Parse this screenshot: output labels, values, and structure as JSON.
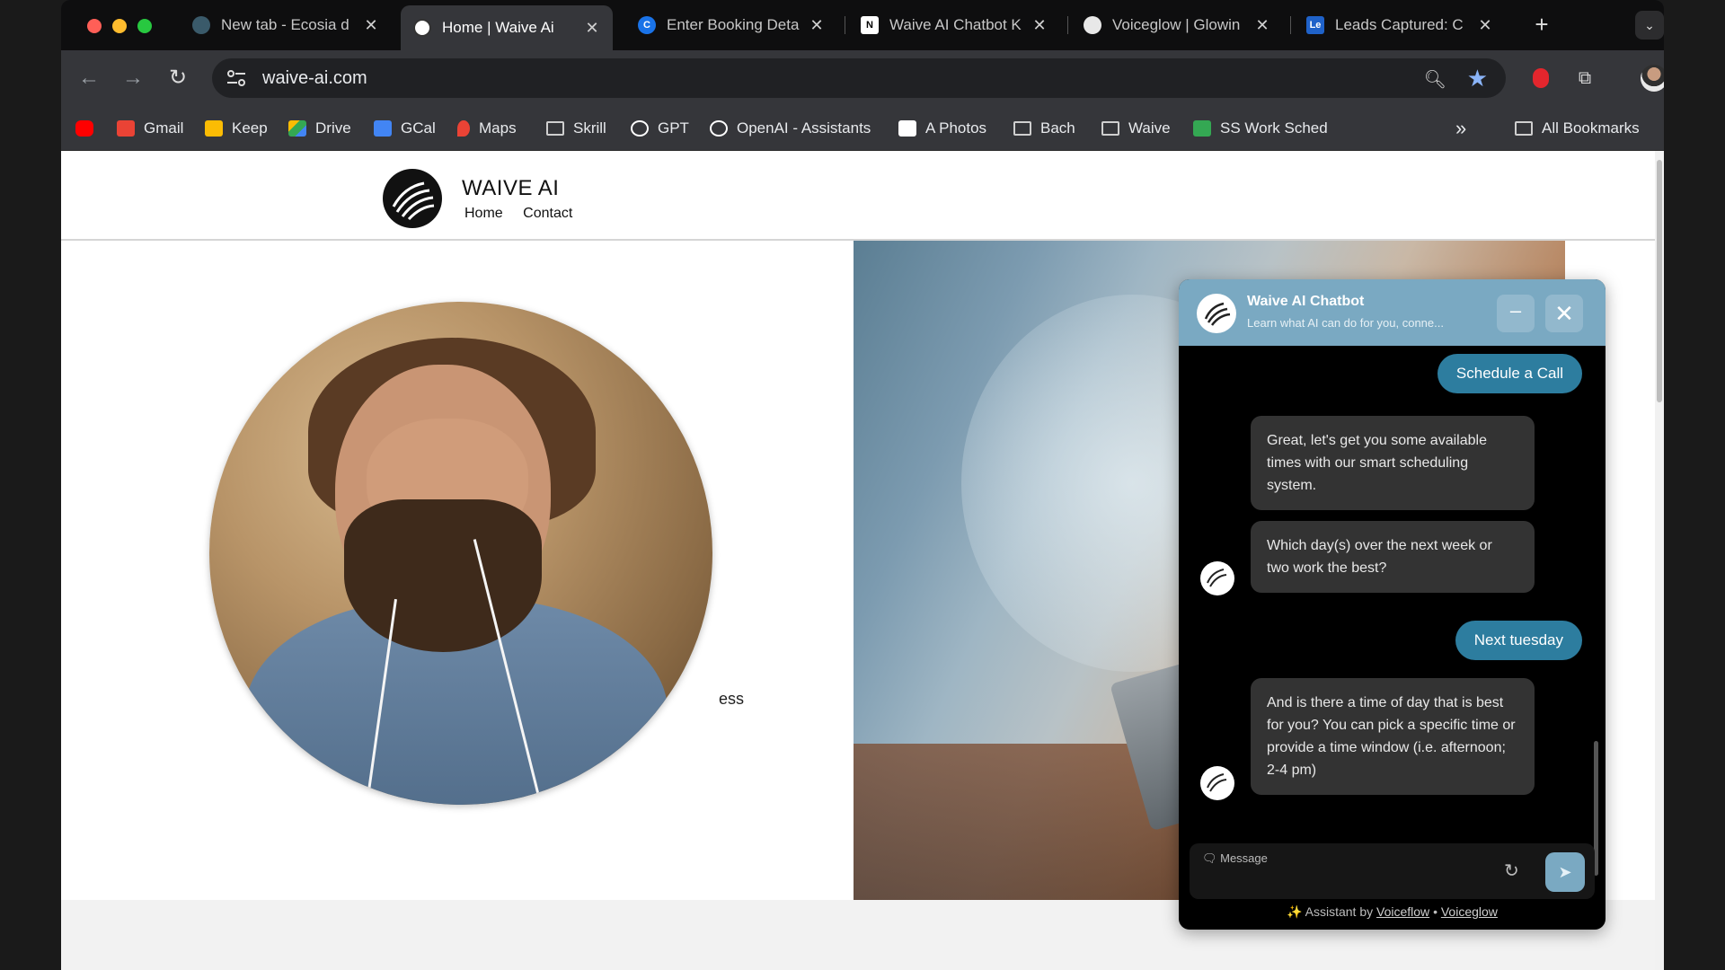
{
  "browser": {
    "tabs": [
      {
        "title": "New tab - Ecosia d",
        "favicon": "ecosia-icon",
        "active": false
      },
      {
        "title": "Home | Waive Ai",
        "favicon": "waive-icon",
        "active": true
      },
      {
        "title": "Enter Booking Deta",
        "favicon": "calendly-icon",
        "active": false
      },
      {
        "title": "Waive AI Chatbot K",
        "favicon": "notion-icon",
        "active": false
      },
      {
        "title": "Voiceglow | Glowin",
        "favicon": "voiceglow-icon",
        "active": false
      },
      {
        "title": "Leads Captured: C",
        "favicon": "le-icon",
        "active": false
      }
    ],
    "le_favicon_text": "Le",
    "address": "waive-ai.com",
    "bookmarks": [
      {
        "label": "",
        "icon": "youtube-icon",
        "color": "#ff0000"
      },
      {
        "label": "Gmail",
        "icon": "gmail-icon",
        "color": "#ea4335"
      },
      {
        "label": "Keep",
        "icon": "keep-icon",
        "color": "#fbbc04"
      },
      {
        "label": "Drive",
        "icon": "drive-icon",
        "color": "#34a853"
      },
      {
        "label": "GCal",
        "icon": "gcal-icon",
        "color": "#4285f4"
      },
      {
        "label": "Maps",
        "icon": "maps-icon",
        "color": "#ea4335"
      },
      {
        "label": "Skrill",
        "icon": "folder-icon",
        "color": "#cfcfcf"
      },
      {
        "label": "GPT",
        "icon": "openai-icon",
        "color": "#ffffff"
      },
      {
        "label": "OpenAI - Assistants",
        "icon": "openai-icon",
        "color": "#ffffff"
      },
      {
        "label": "A Photos",
        "icon": "amazon-photos-icon",
        "color": "#ffffff"
      },
      {
        "label": "Bach",
        "icon": "folder-icon",
        "color": "#cfcfcf"
      },
      {
        "label": "Waive",
        "icon": "folder-icon",
        "color": "#cfcfcf"
      },
      {
        "label": "SS Work Sched",
        "icon": "sheets-icon",
        "color": "#34a853"
      }
    ],
    "more_bookmarks": "»",
    "all_bookmarks": "All Bookmarks"
  },
  "site": {
    "title": "WAIVE AI",
    "nav": [
      "Home",
      "Contact"
    ],
    "partial_text": "ess"
  },
  "chat": {
    "title": "Waive AI Chatbot",
    "subtitle": "Learn what AI can do for you, conne...",
    "messages": [
      {
        "role": "user",
        "text": "Schedule a Call"
      },
      {
        "role": "bot",
        "text": "Great, let's get you some available times with our smart scheduling system."
      },
      {
        "role": "bot",
        "text": "Which day(s) over the next week or two work the best?"
      },
      {
        "role": "user",
        "text": "Next tuesday"
      },
      {
        "role": "bot",
        "text": "And is there a time of day that is best for you? You can pick a specific time or provide a time window (i.e. afternoon; 2-4 pm)"
      }
    ],
    "input_placeholder": "Message",
    "footer_prefix": "✨ Assistant by",
    "footer_link1": "Voiceflow",
    "footer_sep": "•",
    "footer_link2": "Voiceglow"
  },
  "colors": {
    "chat_accent": "#7aa9c2",
    "user_bubble": "#2d7d9f",
    "bot_bubble": "#333333"
  }
}
